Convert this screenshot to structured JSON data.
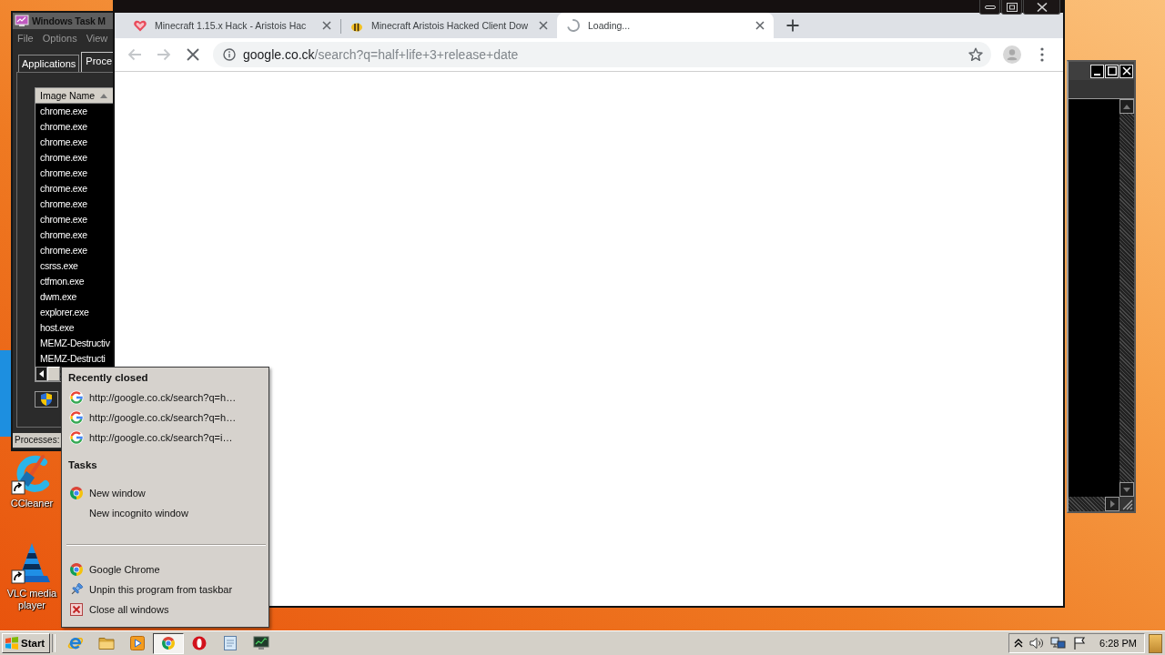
{
  "task_manager": {
    "title": "Windows Task M",
    "menu": [
      "File",
      "Options",
      "View"
    ],
    "tabs": [
      {
        "label": "Applications",
        "selected": false
      },
      {
        "label": "Proce",
        "selected": true
      }
    ],
    "column": "Image Name",
    "processes": [
      "chrome.exe",
      "chrome.exe",
      "chrome.exe",
      "chrome.exe",
      "chrome.exe",
      "chrome.exe",
      "chrome.exe",
      "chrome.exe",
      "chrome.exe",
      "chrome.exe",
      "csrss.exe",
      "ctfmon.exe",
      "dwm.exe",
      "explorer.exe",
      "host.exe",
      "MEMZ-Destructiv",
      "MEMZ-Destructi"
    ],
    "status": "Processes:"
  },
  "browser": {
    "tabs": [
      {
        "title": "Minecraft 1.15.x Hack - Aristois Hac",
        "selected": false,
        "loading": false
      },
      {
        "title": "Minecraft Aristois Hacked Client Dow",
        "selected": false,
        "loading": false
      },
      {
        "title": "Loading...",
        "selected": true,
        "loading": true
      }
    ],
    "back": {
      "disabled": true
    },
    "forward": {
      "disabled": true
    },
    "url_host": "google.co.ck",
    "url_path": "/search?q=half+life+3+release+date"
  },
  "desktop_icons": [
    {
      "label": "CCleaner"
    },
    {
      "label": "VLC media player"
    }
  ],
  "jump_list": {
    "sections": [
      {
        "heading": "Recently closed",
        "items": [
          {
            "kind": "page",
            "label": "http://google.co.ck/search?q=h…"
          },
          {
            "kind": "page",
            "label": "http://google.co.ck/search?q=h…"
          },
          {
            "kind": "page",
            "label": "http://google.co.ck/search?q=i…"
          }
        ]
      },
      {
        "heading": "Tasks",
        "items": [
          {
            "kind": "window",
            "label": "New window"
          },
          {
            "kind": "incognito",
            "label": "New incognito window"
          }
        ]
      }
    ],
    "pinned": [
      {
        "kind": "app",
        "label": "Google Chrome"
      },
      {
        "kind": "unpin",
        "label": "Unpin this program from taskbar"
      },
      {
        "kind": "close",
        "label": "Close all windows"
      }
    ]
  },
  "taskbar": {
    "start": "Start",
    "apps": [
      {
        "selected": false
      },
      {
        "selected": false
      },
      {
        "selected": false
      },
      {
        "selected": true
      },
      {
        "selected": false
      },
      {
        "selected": false
      },
      {
        "selected": false
      }
    ],
    "clock": "6:28 PM"
  }
}
